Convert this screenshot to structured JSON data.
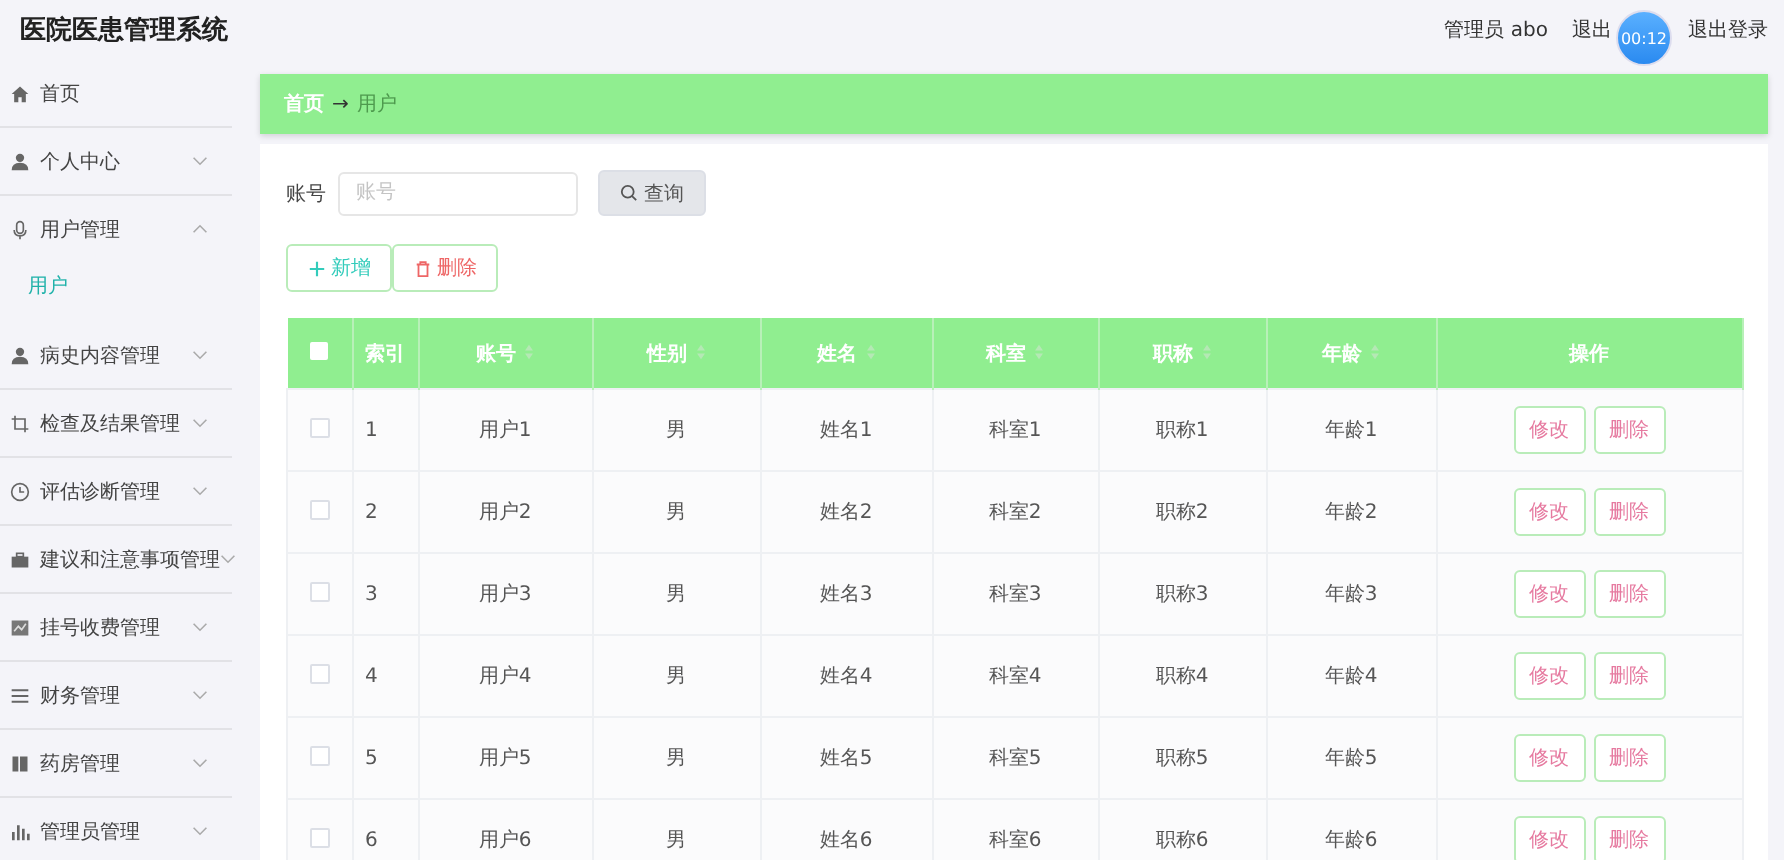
{
  "header": {
    "title": "医院医患管理系统",
    "user": "管理员 abo",
    "links": [
      "退出",
      "退出登录"
    ],
    "timer": "00:12"
  },
  "sidebar": {
    "items": [
      {
        "label": "首页"
      },
      {
        "label": "个人中心",
        "expanded": false
      },
      {
        "label": "用户管理",
        "expanded": true,
        "children": [
          {
            "label": "用户",
            "selected": true
          }
        ]
      },
      {
        "label": "病史内容管理",
        "expanded": false
      },
      {
        "label": "检查及结果管理",
        "expanded": false
      },
      {
        "label": "评估诊断管理",
        "expanded": false
      },
      {
        "label": "建议和注意事项管理",
        "expanded": false
      },
      {
        "label": "挂号收费管理",
        "expanded": false
      },
      {
        "label": "财务管理",
        "expanded": false
      },
      {
        "label": "药房管理",
        "expanded": false
      },
      {
        "label": "管理员管理",
        "expanded": false
      }
    ]
  },
  "breadcrumb": {
    "separator": "→",
    "items": [
      "首页",
      "用户"
    ]
  },
  "search": {
    "label": "账号",
    "placeholder": "账号",
    "button": "查询"
  },
  "actions": [
    "新增",
    "删除"
  ],
  "table": {
    "all_checked": false,
    "columns": [
      {
        "label": "索引",
        "sortable": false
      },
      {
        "label": "账号",
        "sortable": true
      },
      {
        "label": "性别",
        "sortable": true
      },
      {
        "label": "姓名",
        "sortable": true
      },
      {
        "label": "科室",
        "sortable": true
      },
      {
        "label": "职称",
        "sortable": true
      },
      {
        "label": "年龄",
        "sortable": true
      },
      {
        "label": "操作",
        "sortable": false
      }
    ],
    "rows": [
      {
        "checked": false,
        "cells": [
          "1",
          "用户1",
          "男",
          "姓名1",
          "科室1",
          "职称1",
          "年龄1"
        ],
        "buttons": [
          "修改",
          "删除"
        ]
      },
      {
        "checked": false,
        "cells": [
          "2",
          "用户2",
          "男",
          "姓名2",
          "科室2",
          "职称2",
          "年龄2"
        ],
        "buttons": [
          "修改",
          "删除"
        ]
      },
      {
        "checked": false,
        "cells": [
          "3",
          "用户3",
          "男",
          "姓名3",
          "科室3",
          "职称3",
          "年龄3"
        ],
        "buttons": [
          "修改",
          "删除"
        ]
      },
      {
        "checked": false,
        "cells": [
          "4",
          "用户4",
          "男",
          "姓名4",
          "科室4",
          "职称4",
          "年龄4"
        ],
        "buttons": [
          "修改",
          "删除"
        ]
      },
      {
        "checked": false,
        "cells": [
          "5",
          "用户5",
          "男",
          "姓名5",
          "科室5",
          "职称5",
          "年龄5"
        ],
        "buttons": [
          "修改",
          "删除"
        ]
      },
      {
        "checked": false,
        "cells": [
          "6",
          "用户6",
          "男",
          "姓名6",
          "科室6",
          "职称6",
          "年龄6"
        ],
        "buttons": [
          "修改",
          "删除"
        ]
      }
    ]
  }
}
